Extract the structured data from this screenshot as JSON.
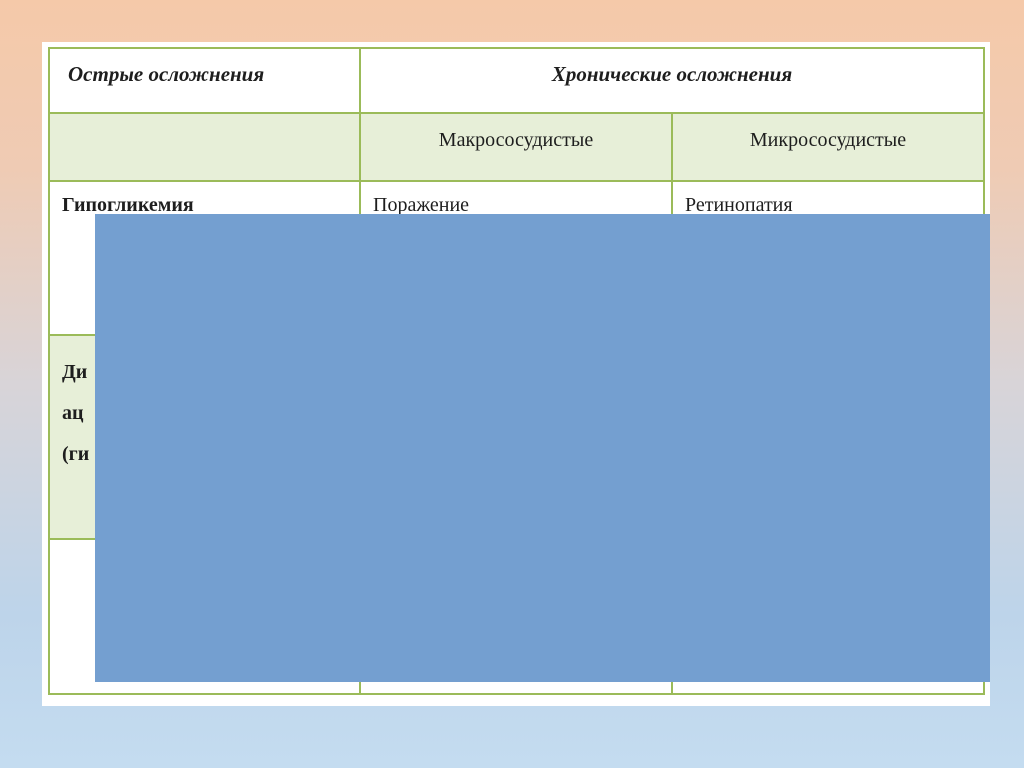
{
  "table": {
    "header": {
      "acute": "Острые осложнения",
      "chronic": "Хронические осложнения"
    },
    "subheader": {
      "macro": "Макрососудистые",
      "micro": "Микрососудистые"
    },
    "row1": {
      "acute": "Гипогликемия",
      "macro": "Поражение",
      "micro": "Ретинопатия"
    },
    "row2": {
      "line1": "Ди",
      "line2": "ац",
      "line3": "(ги"
    }
  },
  "colors": {
    "border": "#9bbb59",
    "band": "#e7efd8",
    "overlay": "#749fd0"
  }
}
